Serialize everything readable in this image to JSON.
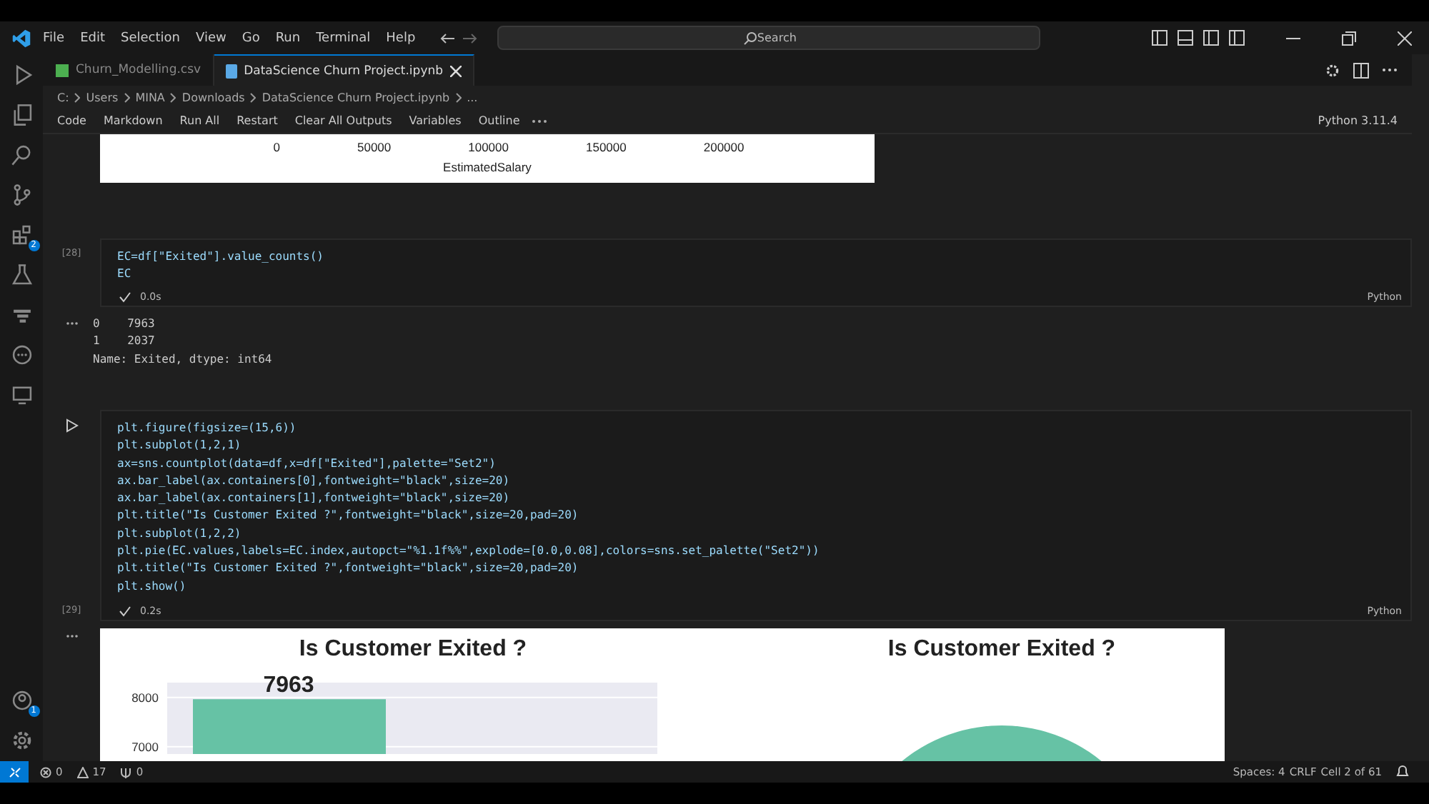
{
  "menu": [
    "File",
    "Edit",
    "Selection",
    "View",
    "Go",
    "Run",
    "Terminal",
    "Help"
  ],
  "search": {
    "placeholder": "Search"
  },
  "activity_bar": {
    "extensions_badge": "2",
    "accounts_badge": "1"
  },
  "tabs": [
    {
      "label": "Churn_Modelling.csv",
      "selected": false,
      "kind": "csv"
    },
    {
      "label": "DataScience Churn Project.ipynb",
      "selected": true,
      "kind": "notebook"
    }
  ],
  "breadcrumb": [
    "C:",
    "Users",
    "MINA",
    "Downloads",
    "DataScience Churn Project.ipynb",
    "..."
  ],
  "toolbar": [
    "Code",
    "Markdown",
    "Run All",
    "Restart",
    "Clear All Outputs",
    "Variables",
    "Outline"
  ],
  "kernel": "Python 3.11.4",
  "output_plot": {
    "xticks": [
      "0",
      "50000",
      "100000",
      "150000",
      "200000"
    ],
    "xlabel": "EstimatedSalary"
  },
  "cells": [
    {
      "count": "[28]",
      "time": "0.0s",
      "language": "Python",
      "code": [
        "EC=df[\"Exited\"].value_counts()",
        "EC"
      ],
      "output": [
        "0    7963",
        "1    2037",
        "Name: Exited, dtype: int64"
      ]
    },
    {
      "count": "[29]",
      "time": "0.2s",
      "language": "Python",
      "code": [
        "plt.figure(figsize=(15,6))",
        "plt.subplot(1,2,1)",
        "ax=sns.countplot(data=df,x=df[\"Exited\"],palette=\"Set2\")",
        "ax.bar_label(ax.containers[0],fontweight=\"black\",size=20)",
        "ax.bar_label(ax.containers[1],fontweight=\"black\",size=20)",
        "plt.title(\"Is Customer Exited ?\",fontweight=\"black\",size=20,pad=20)",
        "plt.subplot(1,2,2)",
        "plt.pie(EC.values,labels=EC.index,autopct=\"%1.1f%%\",explode=[0.0,0.08],colors=sns.set_palette(\"Set2\"))",
        "plt.title(\"Is Customer Exited ?\",fontweight=\"black\",size=20,pad=20)",
        "plt.show()"
      ]
    }
  ],
  "figure": {
    "chart_data": {
      "type": "bar",
      "title": "Is Customer Exited ?",
      "values": [
        7963
      ],
      "ylim": [
        6850,
        8300
      ],
      "yticks": [
        7000,
        8000
      ],
      "data_labels": true
    },
    "pie_title": "Is Customer Exited ?"
  },
  "status_bar": {
    "errors": "0",
    "warnings": "17",
    "ports": "0",
    "spaces": "Spaces: 4",
    "eol": "CRLF",
    "cell": "Cell 2 of 61"
  }
}
